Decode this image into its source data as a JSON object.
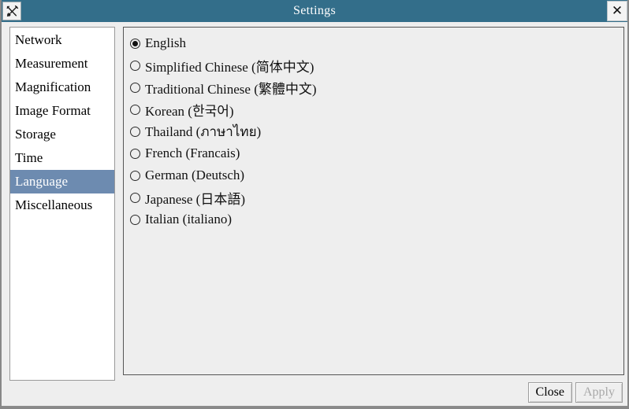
{
  "window": {
    "title": "Settings",
    "icon": "tools-icon",
    "close_icon": "close-icon",
    "titlebar_color": "#336e8a",
    "background_color": "#eeeeee"
  },
  "sidebar": {
    "selected_index": 6,
    "selected_bg": "#6d8bb0",
    "items": [
      {
        "label": "Network"
      },
      {
        "label": "Measurement"
      },
      {
        "label": "Magnification"
      },
      {
        "label": "Image Format"
      },
      {
        "label": "Storage"
      },
      {
        "label": "Time"
      },
      {
        "label": "Language"
      },
      {
        "label": "Miscellaneous"
      }
    ]
  },
  "panel": {
    "group": "language",
    "selected_value": "english",
    "options": [
      {
        "value": "english",
        "label": "English",
        "checked": true
      },
      {
        "value": "simplified_chinese",
        "label": "Simplified Chinese (简体中文)",
        "checked": false
      },
      {
        "value": "traditional_chinese",
        "label": "Traditional Chinese (繁體中文)",
        "checked": false
      },
      {
        "value": "korean",
        "label": "Korean (한국어)",
        "checked": false
      },
      {
        "value": "thailand",
        "label": "Thailand (ภาษาไทย)",
        "checked": false
      },
      {
        "value": "french",
        "label": "French (Francais)",
        "checked": false
      },
      {
        "value": "german",
        "label": "German (Deutsch)",
        "checked": false
      },
      {
        "value": "japanese",
        "label": "Japanese (日本語)",
        "checked": false
      },
      {
        "value": "italian",
        "label": "Italian (italiano)",
        "checked": false
      }
    ]
  },
  "footer": {
    "close_label": "Close",
    "apply_label": "Apply",
    "apply_disabled": true
  }
}
